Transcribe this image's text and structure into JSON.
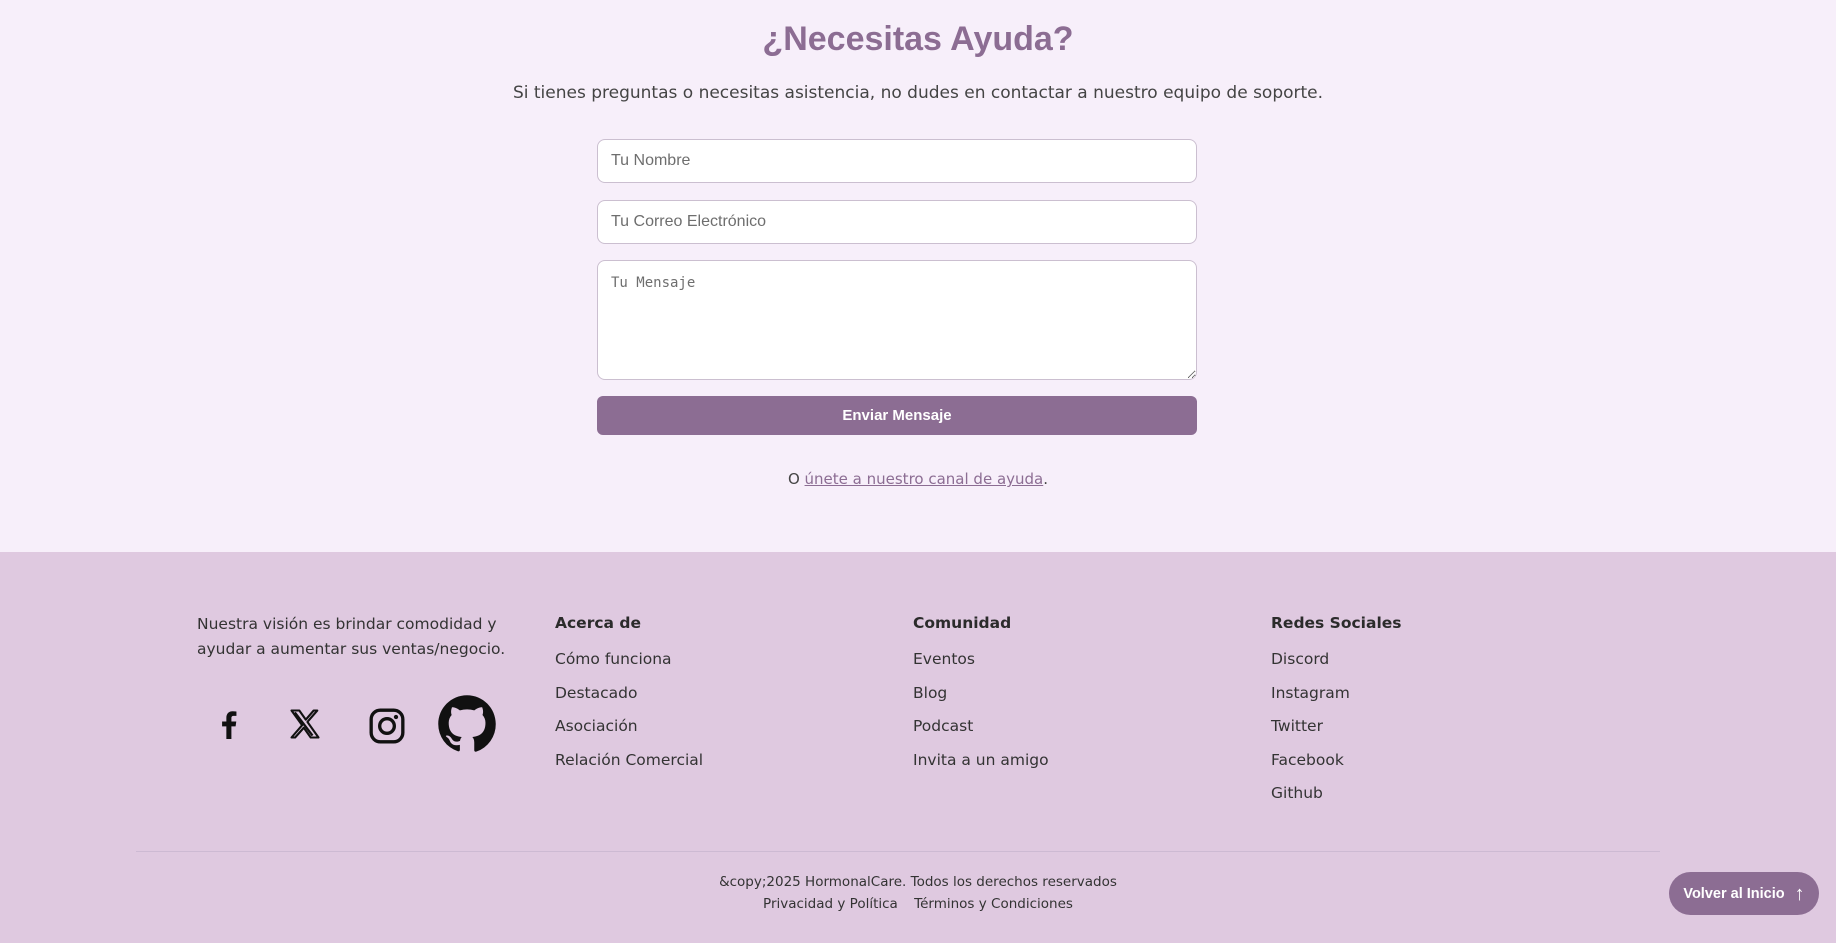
{
  "help": {
    "title": "¿Necesitas Ayuda?",
    "subtitle": "Si tienes preguntas o necesitas asistencia, no dudes en contactar a nuestro equipo de soporte.",
    "name_placeholder": "Tu Nombre",
    "email_placeholder": "Tu Correo Electrónico",
    "message_placeholder": "Tu Mensaje",
    "name_value": "",
    "email_value": "",
    "message_value": "",
    "send_label": "Enviar Mensaje",
    "join_prefix": "O ",
    "join_link": "únete a nuestro canal de ayuda",
    "join_suffix": "."
  },
  "footer": {
    "vision": "Nuestra visión es brindar comodidad y ayudar a aumentar sus ventas/negocio.",
    "social_icons": [
      "facebook-icon",
      "x-icon",
      "instagram-icon",
      "github-icon"
    ],
    "about": {
      "heading": "Acerca de",
      "items": [
        "Cómo funciona",
        "Destacado",
        "Asociación",
        "Relación Comercial"
      ]
    },
    "community": {
      "heading": "Comunidad",
      "items": [
        "Eventos",
        "Blog",
        "Podcast",
        "Invita a un amigo"
      ]
    },
    "social": {
      "heading": "Redes Sociales",
      "items": [
        "Discord",
        "Instagram",
        "Twitter",
        "Facebook",
        "Github"
      ]
    },
    "copyright": "&copy;2025 HormonalCare. Todos los derechos reservados",
    "privacy": "Privacidad y Política",
    "terms": "Términos y Condiciones"
  },
  "back_to_top": {
    "label": "Volver al Inicio",
    "arrow": "↑"
  },
  "colors": {
    "accent": "#8c6d93",
    "page_bg": "#f7effa",
    "footer_bg": "#dfc9e0"
  }
}
